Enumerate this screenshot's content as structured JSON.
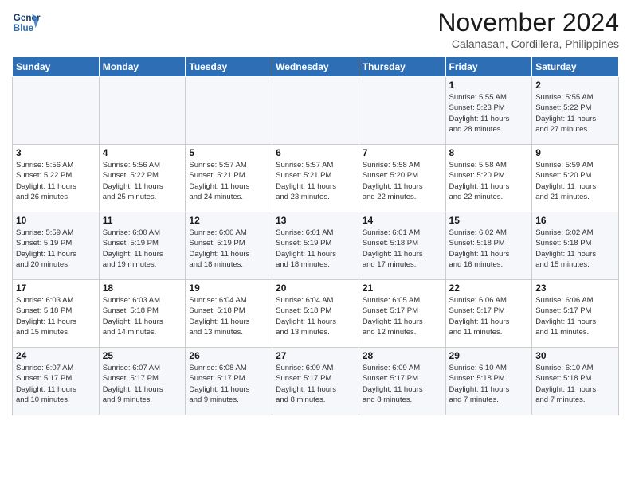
{
  "logo": {
    "line1": "General",
    "line2": "Blue"
  },
  "title": "November 2024",
  "subtitle": "Calanasan, Cordillera, Philippines",
  "days_of_week": [
    "Sunday",
    "Monday",
    "Tuesday",
    "Wednesday",
    "Thursday",
    "Friday",
    "Saturday"
  ],
  "weeks": [
    [
      {
        "num": "",
        "info": ""
      },
      {
        "num": "",
        "info": ""
      },
      {
        "num": "",
        "info": ""
      },
      {
        "num": "",
        "info": ""
      },
      {
        "num": "",
        "info": ""
      },
      {
        "num": "1",
        "info": "Sunrise: 5:55 AM\nSunset: 5:23 PM\nDaylight: 11 hours\nand 28 minutes."
      },
      {
        "num": "2",
        "info": "Sunrise: 5:55 AM\nSunset: 5:22 PM\nDaylight: 11 hours\nand 27 minutes."
      }
    ],
    [
      {
        "num": "3",
        "info": "Sunrise: 5:56 AM\nSunset: 5:22 PM\nDaylight: 11 hours\nand 26 minutes."
      },
      {
        "num": "4",
        "info": "Sunrise: 5:56 AM\nSunset: 5:22 PM\nDaylight: 11 hours\nand 25 minutes."
      },
      {
        "num": "5",
        "info": "Sunrise: 5:57 AM\nSunset: 5:21 PM\nDaylight: 11 hours\nand 24 minutes."
      },
      {
        "num": "6",
        "info": "Sunrise: 5:57 AM\nSunset: 5:21 PM\nDaylight: 11 hours\nand 23 minutes."
      },
      {
        "num": "7",
        "info": "Sunrise: 5:58 AM\nSunset: 5:20 PM\nDaylight: 11 hours\nand 22 minutes."
      },
      {
        "num": "8",
        "info": "Sunrise: 5:58 AM\nSunset: 5:20 PM\nDaylight: 11 hours\nand 22 minutes."
      },
      {
        "num": "9",
        "info": "Sunrise: 5:59 AM\nSunset: 5:20 PM\nDaylight: 11 hours\nand 21 minutes."
      }
    ],
    [
      {
        "num": "10",
        "info": "Sunrise: 5:59 AM\nSunset: 5:19 PM\nDaylight: 11 hours\nand 20 minutes."
      },
      {
        "num": "11",
        "info": "Sunrise: 6:00 AM\nSunset: 5:19 PM\nDaylight: 11 hours\nand 19 minutes."
      },
      {
        "num": "12",
        "info": "Sunrise: 6:00 AM\nSunset: 5:19 PM\nDaylight: 11 hours\nand 18 minutes."
      },
      {
        "num": "13",
        "info": "Sunrise: 6:01 AM\nSunset: 5:19 PM\nDaylight: 11 hours\nand 18 minutes."
      },
      {
        "num": "14",
        "info": "Sunrise: 6:01 AM\nSunset: 5:18 PM\nDaylight: 11 hours\nand 17 minutes."
      },
      {
        "num": "15",
        "info": "Sunrise: 6:02 AM\nSunset: 5:18 PM\nDaylight: 11 hours\nand 16 minutes."
      },
      {
        "num": "16",
        "info": "Sunrise: 6:02 AM\nSunset: 5:18 PM\nDaylight: 11 hours\nand 15 minutes."
      }
    ],
    [
      {
        "num": "17",
        "info": "Sunrise: 6:03 AM\nSunset: 5:18 PM\nDaylight: 11 hours\nand 15 minutes."
      },
      {
        "num": "18",
        "info": "Sunrise: 6:03 AM\nSunset: 5:18 PM\nDaylight: 11 hours\nand 14 minutes."
      },
      {
        "num": "19",
        "info": "Sunrise: 6:04 AM\nSunset: 5:18 PM\nDaylight: 11 hours\nand 13 minutes."
      },
      {
        "num": "20",
        "info": "Sunrise: 6:04 AM\nSunset: 5:18 PM\nDaylight: 11 hours\nand 13 minutes."
      },
      {
        "num": "21",
        "info": "Sunrise: 6:05 AM\nSunset: 5:17 PM\nDaylight: 11 hours\nand 12 minutes."
      },
      {
        "num": "22",
        "info": "Sunrise: 6:06 AM\nSunset: 5:17 PM\nDaylight: 11 hours\nand 11 minutes."
      },
      {
        "num": "23",
        "info": "Sunrise: 6:06 AM\nSunset: 5:17 PM\nDaylight: 11 hours\nand 11 minutes."
      }
    ],
    [
      {
        "num": "24",
        "info": "Sunrise: 6:07 AM\nSunset: 5:17 PM\nDaylight: 11 hours\nand 10 minutes."
      },
      {
        "num": "25",
        "info": "Sunrise: 6:07 AM\nSunset: 5:17 PM\nDaylight: 11 hours\nand 9 minutes."
      },
      {
        "num": "26",
        "info": "Sunrise: 6:08 AM\nSunset: 5:17 PM\nDaylight: 11 hours\nand 9 minutes."
      },
      {
        "num": "27",
        "info": "Sunrise: 6:09 AM\nSunset: 5:17 PM\nDaylight: 11 hours\nand 8 minutes."
      },
      {
        "num": "28",
        "info": "Sunrise: 6:09 AM\nSunset: 5:17 PM\nDaylight: 11 hours\nand 8 minutes."
      },
      {
        "num": "29",
        "info": "Sunrise: 6:10 AM\nSunset: 5:18 PM\nDaylight: 11 hours\nand 7 minutes."
      },
      {
        "num": "30",
        "info": "Sunrise: 6:10 AM\nSunset: 5:18 PM\nDaylight: 11 hours\nand 7 minutes."
      }
    ]
  ]
}
